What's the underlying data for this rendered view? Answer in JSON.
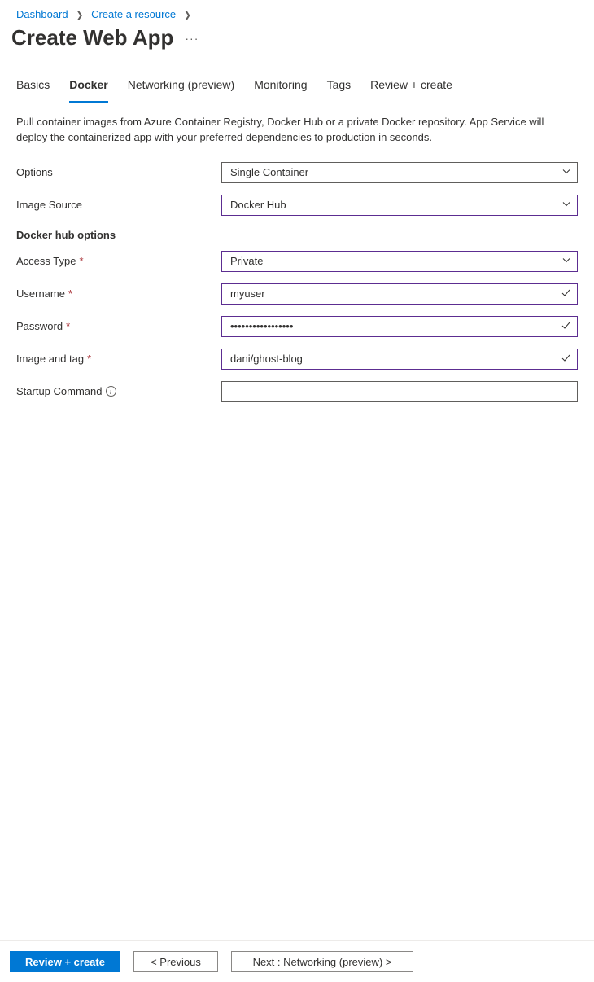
{
  "breadcrumb": {
    "items": [
      "Dashboard",
      "Create a resource"
    ]
  },
  "title": "Create Web App",
  "tabs": {
    "items": [
      "Basics",
      "Docker",
      "Networking (preview)",
      "Monitoring",
      "Tags",
      "Review + create"
    ],
    "activeIndex": 1
  },
  "description": "Pull container images from Azure Container Registry, Docker Hub or a private Docker repository. App Service will deploy the containerized app with your preferred dependencies to production in seconds.",
  "form": {
    "options": {
      "label": "Options",
      "value": "Single Container"
    },
    "imageSource": {
      "label": "Image Source",
      "value": "Docker Hub"
    },
    "sectionHeading": "Docker hub options",
    "accessType": {
      "label": "Access Type",
      "value": "Private"
    },
    "username": {
      "label": "Username",
      "value": "myuser"
    },
    "password": {
      "label": "Password",
      "value": "•••••••••••••••••"
    },
    "imageAndTag": {
      "label": "Image and tag",
      "value": "dani/ghost-blog"
    },
    "startupCommand": {
      "label": "Startup Command",
      "value": ""
    }
  },
  "footer": {
    "review": "Review + create",
    "previous": "<  Previous",
    "next": "Next : Networking (preview)  >"
  }
}
